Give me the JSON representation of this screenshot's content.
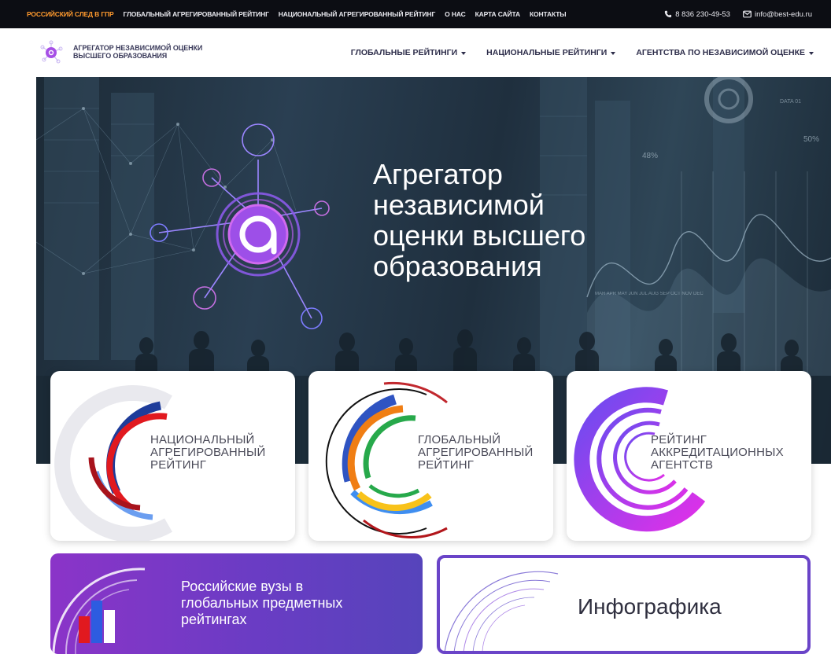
{
  "topbar": {
    "links": [
      "РОССИЙСКИЙ СЛЕД В ГПР",
      "ГЛОБАЛЬНЫЙ АГРЕГИРОВАННЫЙ РЕЙТИНГ",
      "НАЦИОНАЛЬНЫЙ АГРЕГИРОВАННЫЙ РЕЙТИНГ",
      "О НАС",
      "КАРТА САЙТА",
      "КОНТАКТЫ"
    ],
    "phone": "8 836 230-49-53",
    "email": "info@best-edu.ru"
  },
  "header": {
    "brand_line1": "АГРЕГАТОР НЕЗАВИСИМОЙ ОЦЕНКИ",
    "brand_line2": "ВЫСШЕГО ОБРАЗОВАНИЯ",
    "nav": [
      "ГЛОБАЛЬНЫЕ РЕЙТИНГИ",
      "НАЦИОНАЛЬНЫЕ РЕЙТИНГИ",
      "АГЕНТСТВА ПО НЕЗАВИСИМОЙ ОЦЕНКЕ"
    ]
  },
  "hero": {
    "title_lines": [
      "Агрегатор",
      "независимой",
      "оценки высшего",
      "образования"
    ],
    "bg_percent_48": "48%",
    "bg_percent_50": "50%",
    "bg_data": "DATA 01",
    "bg_months": "MAR APR MAY JUN JUL AUG SEP OCT NOV DEC"
  },
  "cards": [
    {
      "lines": [
        "НАЦИОНАЛЬНЫЙ",
        "АГРЕГИРОВАННЫЙ",
        "РЕЙТИНГ"
      ]
    },
    {
      "lines": [
        "ГЛОБАЛЬНЫЙ",
        "АГРЕГИРОВАННЫЙ",
        "РЕЙТИНГ"
      ]
    },
    {
      "lines": [
        "РЕЙТИНГ",
        "АККРЕДИТАЦИОННЫХ",
        "АГЕНТСТВ"
      ]
    }
  ],
  "promos": [
    {
      "lines": [
        "Российские вузы в",
        "глобальных предметных",
        "рейтингах"
      ]
    },
    {
      "text": "Инфографика"
    }
  ],
  "colors": {
    "topbar_bg": "#0c0d13",
    "accent": "#ff9a2e",
    "purple": "#8b34c8",
    "magenta": "#d23fe0"
  },
  "icons": [
    "logo-icon",
    "phone-icon",
    "mail-icon",
    "caret-down-icon",
    "hero-network-icon"
  ]
}
